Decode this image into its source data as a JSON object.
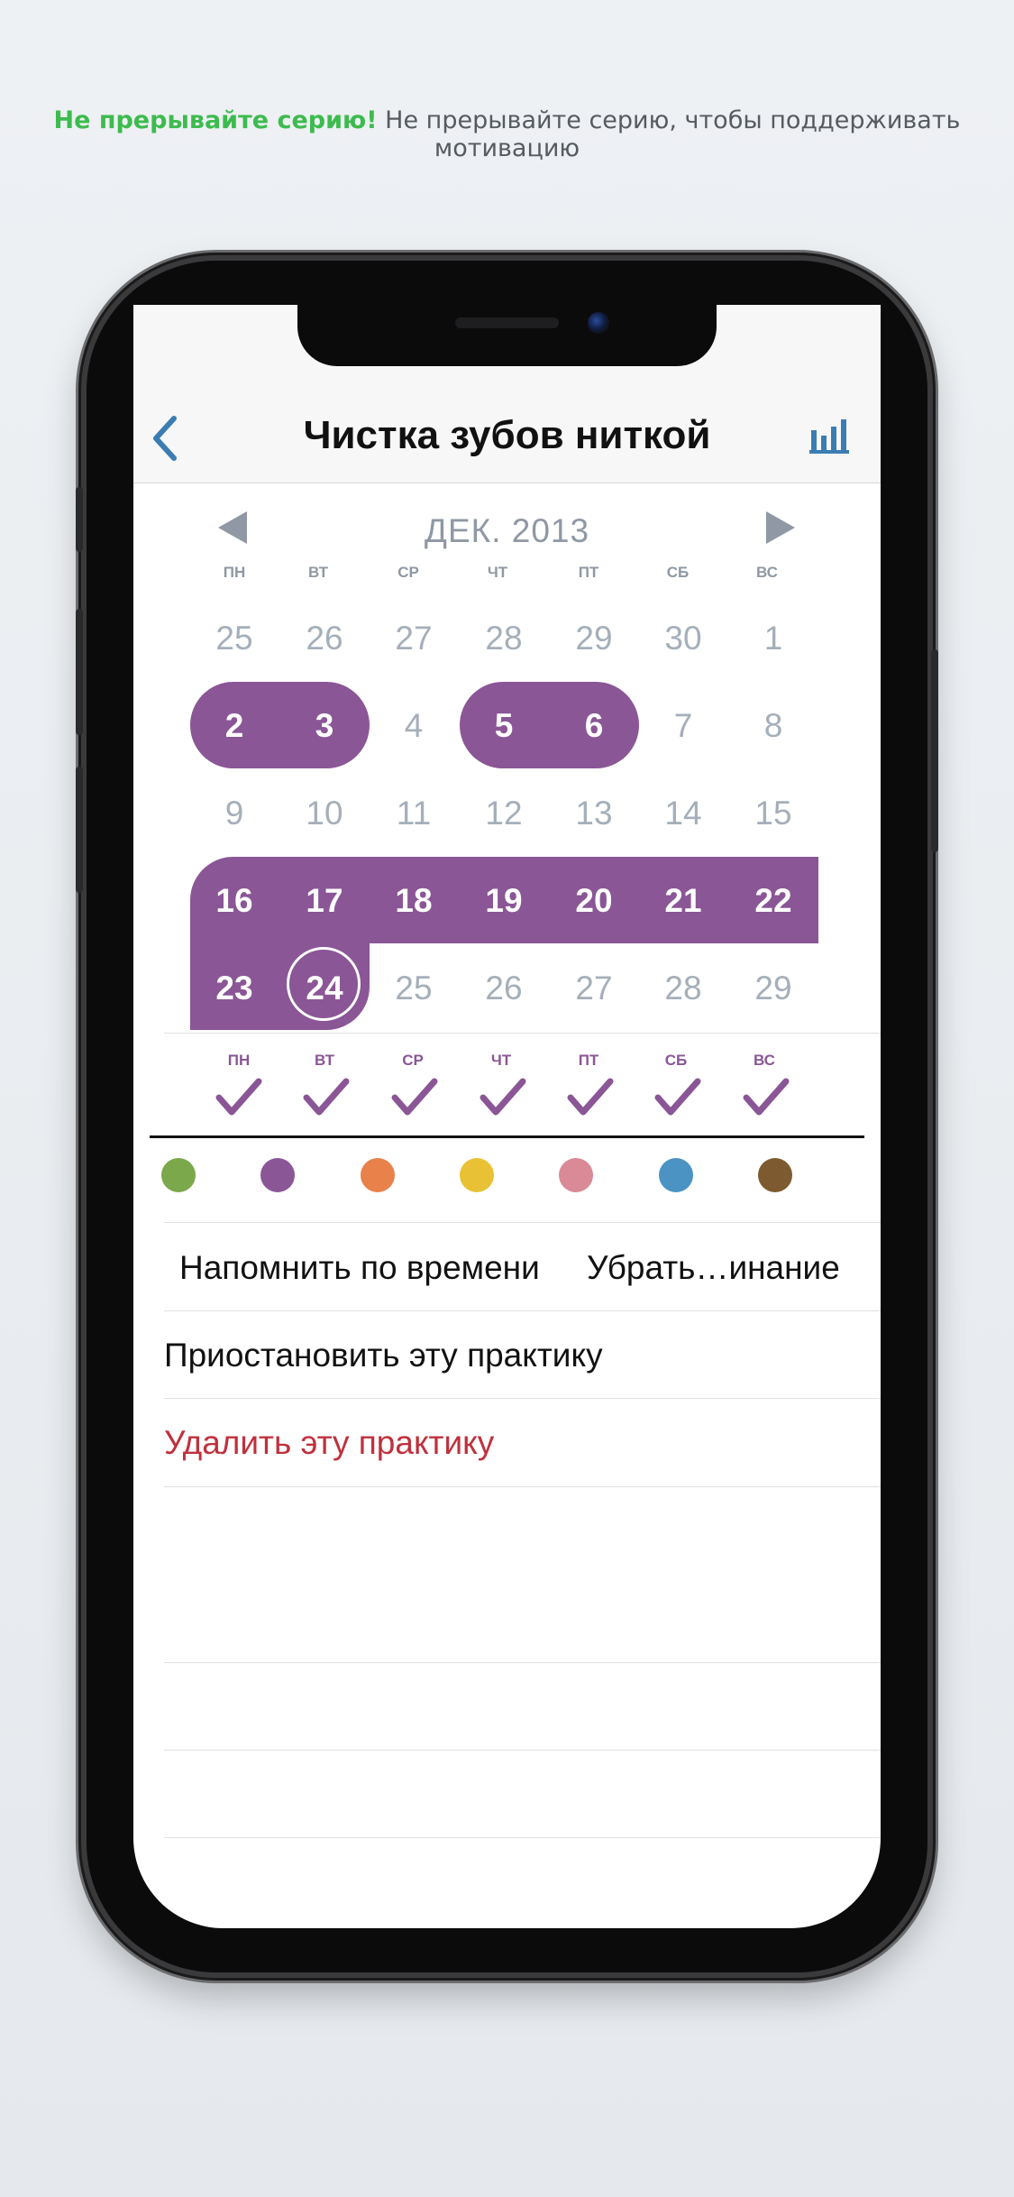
{
  "headline": {
    "highlight": "Не прерывайте серию!",
    "text": "Не прерывайте серию, чтобы поддерживать мотивацию"
  },
  "nav": {
    "title": "Чистка зубов ниткой",
    "back_icon": "chevron-left-icon",
    "stats_icon": "bar-chart-icon",
    "accent": "#3b7db3"
  },
  "calendar": {
    "month": "ДЕК. 2013",
    "weekdays": [
      "ПН",
      "ВТ",
      "СР",
      "ЧТ",
      "ПТ",
      "СБ",
      "ВС"
    ],
    "weeks": [
      [
        "25",
        "26",
        "27",
        "28",
        "29",
        "30",
        "1"
      ],
      [
        "2",
        "3",
        "4",
        "5",
        "6",
        "7",
        "8"
      ],
      [
        "9",
        "10",
        "11",
        "12",
        "13",
        "14",
        "15"
      ],
      [
        "16",
        "17",
        "18",
        "19",
        "20",
        "21",
        "22"
      ],
      [
        "23",
        "24",
        "25",
        "26",
        "27",
        "28",
        "29"
      ]
    ],
    "completed_days": [
      "2",
      "3",
      "5",
      "6",
      "16",
      "17",
      "18",
      "19",
      "20",
      "21",
      "22",
      "23",
      "24"
    ],
    "today": "24",
    "highlight_color": "#8a5696"
  },
  "schedule": {
    "weekdays": [
      "ПН",
      "ВТ",
      "СР",
      "ЧТ",
      "ПТ",
      "СБ",
      "ВС"
    ],
    "checked": [
      true,
      true,
      true,
      true,
      true,
      true,
      true
    ]
  },
  "colors": [
    "#7ba84a",
    "#8a5696",
    "#e8814a",
    "#e8c234",
    "#d98a96",
    "#4a93c3",
    "#7e5a30"
  ],
  "menu": {
    "remind": "Напомнить по времени",
    "remove_reminder": "Убрать…инание",
    "pause": "Приостановить эту практику",
    "delete": "Удалить эту практику"
  }
}
